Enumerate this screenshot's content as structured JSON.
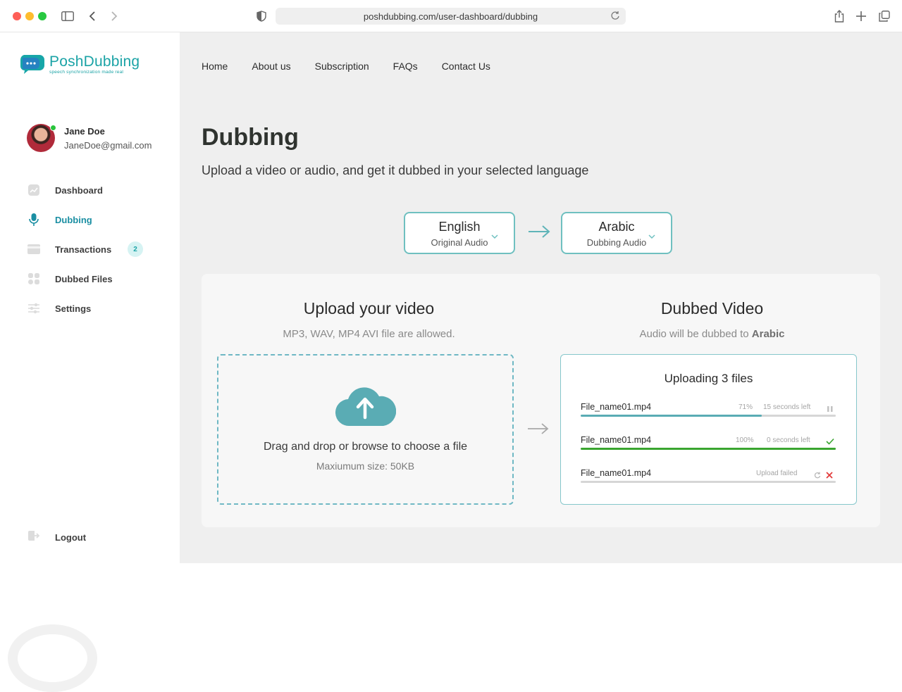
{
  "browser": {
    "url": "poshdubbing.com/user-dashboard/dubbing"
  },
  "logo": {
    "title": "PoshDubbing",
    "tagline": "speech synchronization made real"
  },
  "user": {
    "name": "Jane Doe",
    "email": "JaneDoe@gmail.com"
  },
  "sidebar": {
    "items": [
      {
        "label": "Dashboard",
        "icon": "chart-icon"
      },
      {
        "label": "Dubbing",
        "icon": "microphone-icon",
        "active": true
      },
      {
        "label": "Transactions",
        "icon": "card-icon",
        "badge": "2"
      },
      {
        "label": "Dubbed Files",
        "icon": "grid-icon"
      },
      {
        "label": "Settings",
        "icon": "sliders-icon"
      }
    ],
    "logout_label": "Logout"
  },
  "topnav": {
    "items": [
      "Home",
      "About us",
      "Subscription",
      "FAQs",
      "Contact Us"
    ]
  },
  "page": {
    "title": "Dubbing",
    "subtitle": "Upload a video or audio, and get it dubbed in your selected language"
  },
  "languages": {
    "source": {
      "name": "English",
      "sub": "Original Audio"
    },
    "target": {
      "name": "Arabic",
      "sub": "Dubbing Audio"
    }
  },
  "upload": {
    "title": "Upload your video",
    "allowed": "MP3, WAV, MP4 AVI file are allowed.",
    "drop_text": "Drag and drop or browse to choose a file",
    "max_size": "Maxiumum size: 50KB"
  },
  "dubbed": {
    "title": "Dubbed Video",
    "sub_prefix": "Audio will be dubbed to ",
    "sub_lang": "Arabic",
    "panel_title": "Uploading 3 files",
    "files": [
      {
        "name": "File_name01.mp4",
        "percent_text": "71%",
        "time": "15 seconds left",
        "progress": 0.71,
        "status": "paused"
      },
      {
        "name": "File_name01.mp4",
        "percent_text": "100%",
        "time": "0 seconds left",
        "progress": 1.0,
        "status": "done"
      },
      {
        "name": "File_name01.mp4",
        "percent_text": "",
        "time": "Upload failed",
        "progress": 0,
        "status": "failed"
      }
    ]
  },
  "colors": {
    "accent": "#1ba3a6",
    "progress_active": "#5aacb4",
    "progress_done": "#3aa530",
    "error": "#e23b3b"
  }
}
